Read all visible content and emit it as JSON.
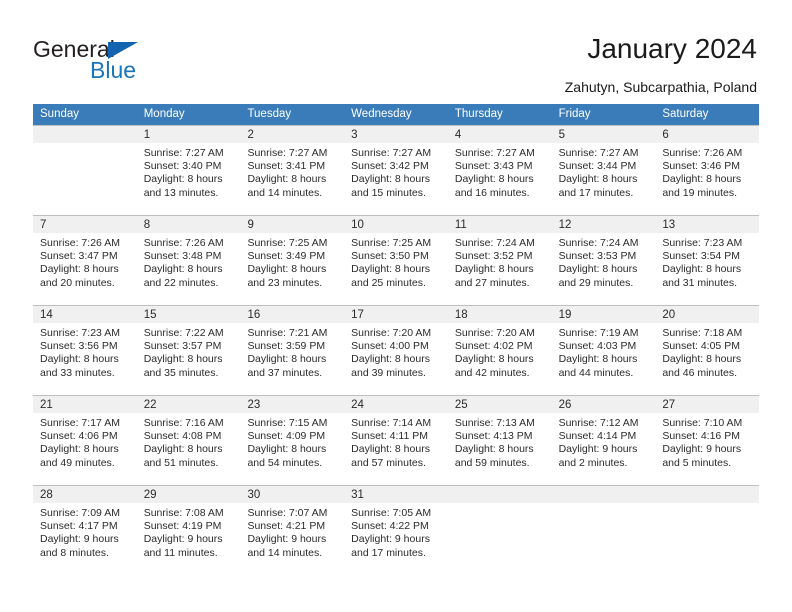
{
  "logo": {
    "word_one": "General",
    "word_two": "Blue",
    "triangle_color": "#1263b0",
    "blue_color": "#1b75bb"
  },
  "header": {
    "title": "January 2024",
    "subtitle": "Zahutyn, Subcarpathia, Poland",
    "header_bg": "#3a7cb9",
    "day_band_bg": "#f0f0f0"
  },
  "weekdays": [
    "Sunday",
    "Monday",
    "Tuesday",
    "Wednesday",
    "Thursday",
    "Friday",
    "Saturday"
  ],
  "weeks": [
    [
      {
        "day": "",
        "sunrise": "",
        "sunset": "",
        "daylight_line1": "",
        "daylight_line2": ""
      },
      {
        "day": "1",
        "sunrise": "Sunrise: 7:27 AM",
        "sunset": "Sunset: 3:40 PM",
        "daylight_line1": "Daylight: 8 hours",
        "daylight_line2": "and 13 minutes."
      },
      {
        "day": "2",
        "sunrise": "Sunrise: 7:27 AM",
        "sunset": "Sunset: 3:41 PM",
        "daylight_line1": "Daylight: 8 hours",
        "daylight_line2": "and 14 minutes."
      },
      {
        "day": "3",
        "sunrise": "Sunrise: 7:27 AM",
        "sunset": "Sunset: 3:42 PM",
        "daylight_line1": "Daylight: 8 hours",
        "daylight_line2": "and 15 minutes."
      },
      {
        "day": "4",
        "sunrise": "Sunrise: 7:27 AM",
        "sunset": "Sunset: 3:43 PM",
        "daylight_line1": "Daylight: 8 hours",
        "daylight_line2": "and 16 minutes."
      },
      {
        "day": "5",
        "sunrise": "Sunrise: 7:27 AM",
        "sunset": "Sunset: 3:44 PM",
        "daylight_line1": "Daylight: 8 hours",
        "daylight_line2": "and 17 minutes."
      },
      {
        "day": "6",
        "sunrise": "Sunrise: 7:26 AM",
        "sunset": "Sunset: 3:46 PM",
        "daylight_line1": "Daylight: 8 hours",
        "daylight_line2": "and 19 minutes."
      }
    ],
    [
      {
        "day": "7",
        "sunrise": "Sunrise: 7:26 AM",
        "sunset": "Sunset: 3:47 PM",
        "daylight_line1": "Daylight: 8 hours",
        "daylight_line2": "and 20 minutes."
      },
      {
        "day": "8",
        "sunrise": "Sunrise: 7:26 AM",
        "sunset": "Sunset: 3:48 PM",
        "daylight_line1": "Daylight: 8 hours",
        "daylight_line2": "and 22 minutes."
      },
      {
        "day": "9",
        "sunrise": "Sunrise: 7:25 AM",
        "sunset": "Sunset: 3:49 PM",
        "daylight_line1": "Daylight: 8 hours",
        "daylight_line2": "and 23 minutes."
      },
      {
        "day": "10",
        "sunrise": "Sunrise: 7:25 AM",
        "sunset": "Sunset: 3:50 PM",
        "daylight_line1": "Daylight: 8 hours",
        "daylight_line2": "and 25 minutes."
      },
      {
        "day": "11",
        "sunrise": "Sunrise: 7:24 AM",
        "sunset": "Sunset: 3:52 PM",
        "daylight_line1": "Daylight: 8 hours",
        "daylight_line2": "and 27 minutes."
      },
      {
        "day": "12",
        "sunrise": "Sunrise: 7:24 AM",
        "sunset": "Sunset: 3:53 PM",
        "daylight_line1": "Daylight: 8 hours",
        "daylight_line2": "and 29 minutes."
      },
      {
        "day": "13",
        "sunrise": "Sunrise: 7:23 AM",
        "sunset": "Sunset: 3:54 PM",
        "daylight_line1": "Daylight: 8 hours",
        "daylight_line2": "and 31 minutes."
      }
    ],
    [
      {
        "day": "14",
        "sunrise": "Sunrise: 7:23 AM",
        "sunset": "Sunset: 3:56 PM",
        "daylight_line1": "Daylight: 8 hours",
        "daylight_line2": "and 33 minutes."
      },
      {
        "day": "15",
        "sunrise": "Sunrise: 7:22 AM",
        "sunset": "Sunset: 3:57 PM",
        "daylight_line1": "Daylight: 8 hours",
        "daylight_line2": "and 35 minutes."
      },
      {
        "day": "16",
        "sunrise": "Sunrise: 7:21 AM",
        "sunset": "Sunset: 3:59 PM",
        "daylight_line1": "Daylight: 8 hours",
        "daylight_line2": "and 37 minutes."
      },
      {
        "day": "17",
        "sunrise": "Sunrise: 7:20 AM",
        "sunset": "Sunset: 4:00 PM",
        "daylight_line1": "Daylight: 8 hours",
        "daylight_line2": "and 39 minutes."
      },
      {
        "day": "18",
        "sunrise": "Sunrise: 7:20 AM",
        "sunset": "Sunset: 4:02 PM",
        "daylight_line1": "Daylight: 8 hours",
        "daylight_line2": "and 42 minutes."
      },
      {
        "day": "19",
        "sunrise": "Sunrise: 7:19 AM",
        "sunset": "Sunset: 4:03 PM",
        "daylight_line1": "Daylight: 8 hours",
        "daylight_line2": "and 44 minutes."
      },
      {
        "day": "20",
        "sunrise": "Sunrise: 7:18 AM",
        "sunset": "Sunset: 4:05 PM",
        "daylight_line1": "Daylight: 8 hours",
        "daylight_line2": "and 46 minutes."
      }
    ],
    [
      {
        "day": "21",
        "sunrise": "Sunrise: 7:17 AM",
        "sunset": "Sunset: 4:06 PM",
        "daylight_line1": "Daylight: 8 hours",
        "daylight_line2": "and 49 minutes."
      },
      {
        "day": "22",
        "sunrise": "Sunrise: 7:16 AM",
        "sunset": "Sunset: 4:08 PM",
        "daylight_line1": "Daylight: 8 hours",
        "daylight_line2": "and 51 minutes."
      },
      {
        "day": "23",
        "sunrise": "Sunrise: 7:15 AM",
        "sunset": "Sunset: 4:09 PM",
        "daylight_line1": "Daylight: 8 hours",
        "daylight_line2": "and 54 minutes."
      },
      {
        "day": "24",
        "sunrise": "Sunrise: 7:14 AM",
        "sunset": "Sunset: 4:11 PM",
        "daylight_line1": "Daylight: 8 hours",
        "daylight_line2": "and 57 minutes."
      },
      {
        "day": "25",
        "sunrise": "Sunrise: 7:13 AM",
        "sunset": "Sunset: 4:13 PM",
        "daylight_line1": "Daylight: 8 hours",
        "daylight_line2": "and 59 minutes."
      },
      {
        "day": "26",
        "sunrise": "Sunrise: 7:12 AM",
        "sunset": "Sunset: 4:14 PM",
        "daylight_line1": "Daylight: 9 hours",
        "daylight_line2": "and 2 minutes."
      },
      {
        "day": "27",
        "sunrise": "Sunrise: 7:10 AM",
        "sunset": "Sunset: 4:16 PM",
        "daylight_line1": "Daylight: 9 hours",
        "daylight_line2": "and 5 minutes."
      }
    ],
    [
      {
        "day": "28",
        "sunrise": "Sunrise: 7:09 AM",
        "sunset": "Sunset: 4:17 PM",
        "daylight_line1": "Daylight: 9 hours",
        "daylight_line2": "and 8 minutes."
      },
      {
        "day": "29",
        "sunrise": "Sunrise: 7:08 AM",
        "sunset": "Sunset: 4:19 PM",
        "daylight_line1": "Daylight: 9 hours",
        "daylight_line2": "and 11 minutes."
      },
      {
        "day": "30",
        "sunrise": "Sunrise: 7:07 AM",
        "sunset": "Sunset: 4:21 PM",
        "daylight_line1": "Daylight: 9 hours",
        "daylight_line2": "and 14 minutes."
      },
      {
        "day": "31",
        "sunrise": "Sunrise: 7:05 AM",
        "sunset": "Sunset: 4:22 PM",
        "daylight_line1": "Daylight: 9 hours",
        "daylight_line2": "and 17 minutes."
      },
      {
        "day": "",
        "sunrise": "",
        "sunset": "",
        "daylight_line1": "",
        "daylight_line2": ""
      },
      {
        "day": "",
        "sunrise": "",
        "sunset": "",
        "daylight_line1": "",
        "daylight_line2": ""
      },
      {
        "day": "",
        "sunrise": "",
        "sunset": "",
        "daylight_line1": "",
        "daylight_line2": ""
      }
    ]
  ]
}
